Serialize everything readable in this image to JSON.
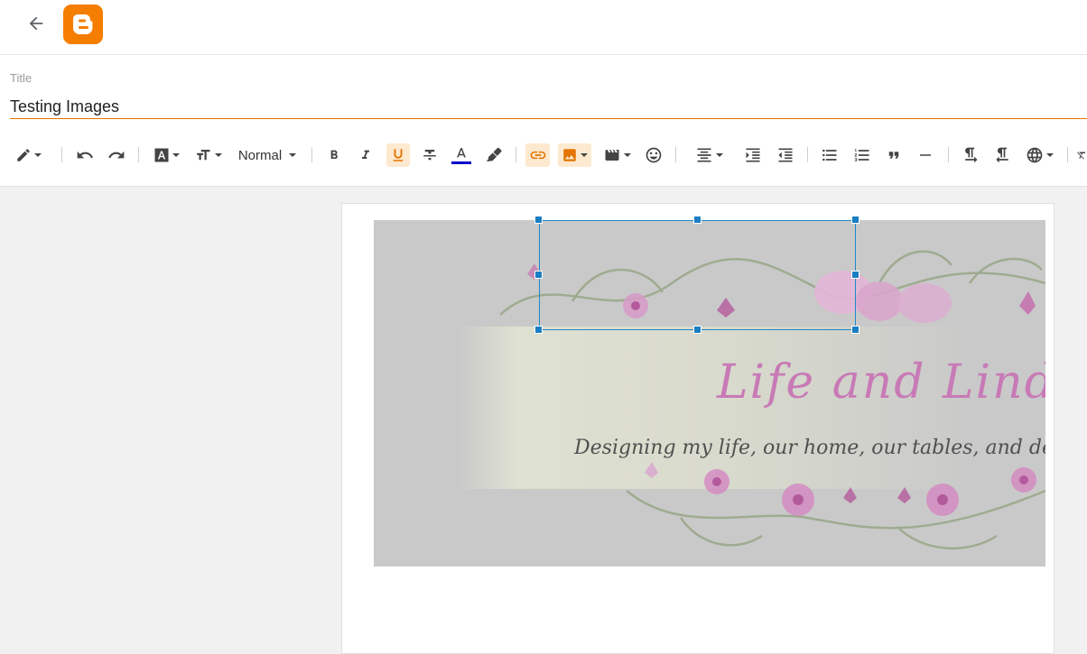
{
  "header": {
    "back_icon": "arrow-left-icon",
    "logo_icon": "blogger-logo-icon",
    "brand_color": "#f57d00"
  },
  "title": {
    "label": "Title",
    "value": "Testing Images",
    "accent_color": "#e37400"
  },
  "toolbar": {
    "text_style_value": "Normal",
    "active_color": "#fde9cf",
    "text_color_bar": "#0000cc",
    "buttons": [
      {
        "name": "pen-mode",
        "icon": "pencil-icon"
      },
      {
        "name": "undo",
        "icon": "undo-icon"
      },
      {
        "name": "redo",
        "icon": "redo-icon"
      },
      {
        "name": "font",
        "icon": "font-icon"
      },
      {
        "name": "font-size",
        "icon": "text-size-icon"
      },
      {
        "name": "bold",
        "icon": "bold-icon"
      },
      {
        "name": "italic",
        "icon": "italic-icon"
      },
      {
        "name": "underline",
        "icon": "underline-icon"
      },
      {
        "name": "strikethrough",
        "icon": "strikethrough-icon"
      },
      {
        "name": "text-color",
        "icon": "text-color-icon"
      },
      {
        "name": "highlight",
        "icon": "marker-icon"
      },
      {
        "name": "link",
        "icon": "link-icon"
      },
      {
        "name": "image",
        "icon": "image-icon"
      },
      {
        "name": "video",
        "icon": "video-icon"
      },
      {
        "name": "emoji",
        "icon": "emoji-icon"
      },
      {
        "name": "align",
        "icon": "align-center-icon"
      },
      {
        "name": "indent",
        "icon": "indent-icon"
      },
      {
        "name": "outdent",
        "icon": "outdent-icon"
      },
      {
        "name": "bulleted-list",
        "icon": "bulleted-list-icon"
      },
      {
        "name": "numbered-list",
        "icon": "numbered-list-icon"
      },
      {
        "name": "quote",
        "icon": "quote-icon"
      },
      {
        "name": "horizontal-rule",
        "icon": "horizontal-rule-icon"
      },
      {
        "name": "ltr",
        "icon": "ltr-paragraph-icon"
      },
      {
        "name": "rtl",
        "icon": "rtl-paragraph-icon"
      },
      {
        "name": "language",
        "icon": "globe-icon"
      },
      {
        "name": "clear-format",
        "icon": "clear-format-icon"
      }
    ]
  },
  "editor": {
    "image_title": "Life and Lind",
    "image_subtitle": "Designing my life,  our home, our tables, and de",
    "selection_color": "#1a7ec2"
  }
}
